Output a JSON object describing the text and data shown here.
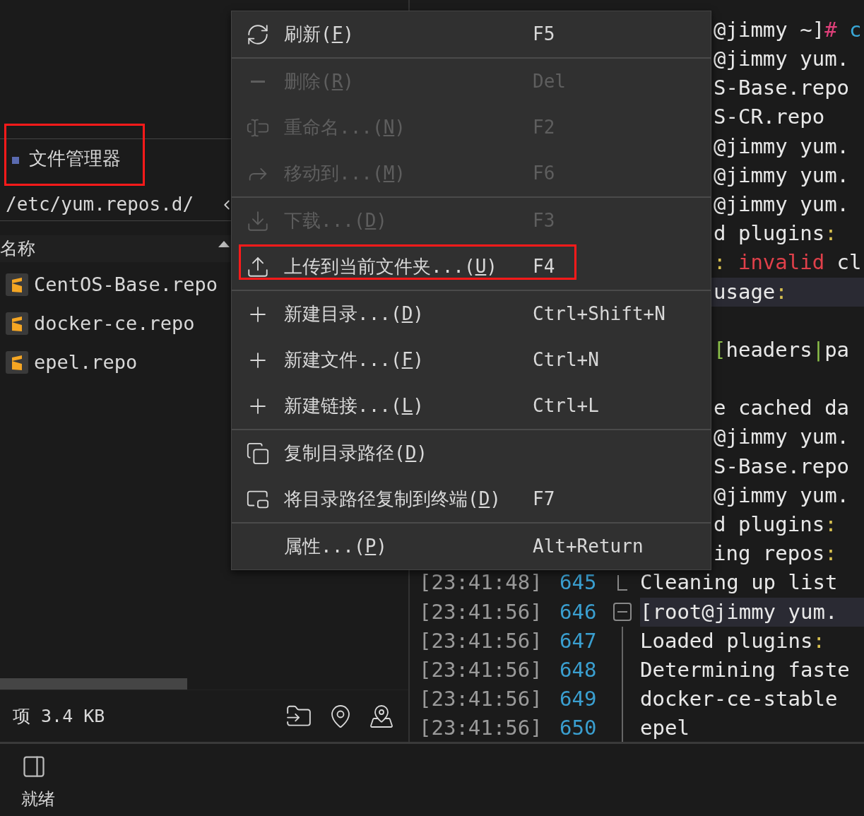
{
  "file_manager": {
    "tab": {
      "label": "文件管理器",
      "highlighted": true
    },
    "path": "/etc/yum.repos.d/",
    "column_header": "名称",
    "files": [
      {
        "name": "CentOS-Base.repo"
      },
      {
        "name": "docker-ce.repo"
      },
      {
        "name": "epel.repo"
      }
    ],
    "status": "项 3.4 KB"
  },
  "terminal": {
    "rows": [
      {
        "kind": "fragment",
        "highlighted": false,
        "segments": [
          {
            "text": "@jimmy ~]",
            "color": "#e8e8e8"
          },
          {
            "text": "#",
            "color": "#e0407a"
          },
          {
            "text": " c",
            "color": "#39a8d8"
          }
        ]
      },
      {
        "kind": "fragment",
        "highlighted": false,
        "segments": [
          {
            "text": "@jimmy yum.",
            "color": "#e8e8e8"
          }
        ]
      },
      {
        "kind": "fragment",
        "highlighted": false,
        "segments": [
          {
            "text": "S-Base.repo",
            "color": "#e8e8e8"
          }
        ]
      },
      {
        "kind": "fragment",
        "highlighted": false,
        "segments": [
          {
            "text": "S-CR.repo",
            "color": "#e8e8e8"
          }
        ]
      },
      {
        "kind": "fragment",
        "highlighted": false,
        "segments": [
          {
            "text": "@jimmy yum.",
            "color": "#e8e8e8"
          }
        ]
      },
      {
        "kind": "fragment",
        "highlighted": false,
        "segments": [
          {
            "text": "@jimmy yum.",
            "color": "#e8e8e8"
          }
        ]
      },
      {
        "kind": "fragment",
        "highlighted": false,
        "segments": [
          {
            "text": "@jimmy yum.",
            "color": "#e8e8e8"
          }
        ]
      },
      {
        "kind": "fragment",
        "highlighted": false,
        "segments": [
          {
            "text": "d plugins",
            "color": "#e8e8e8"
          },
          {
            "text": ":",
            "color": "#d8c050"
          }
        ]
      },
      {
        "kind": "fragment",
        "highlighted": false,
        "segments": [
          {
            "text": ":",
            "color": "#d8c050"
          },
          {
            "text": " invalid",
            "color": "#e0404a"
          },
          {
            "text": " cl",
            "color": "#e8e8e8"
          }
        ]
      },
      {
        "kind": "fragment",
        "highlighted": true,
        "segments": [
          {
            "text": "usage",
            "color": "#e8e8e8"
          },
          {
            "text": ":",
            "color": "#d8c050"
          }
        ]
      },
      {
        "kind": "blank"
      },
      {
        "kind": "fragment",
        "highlighted": false,
        "segments": [
          {
            "text": "[",
            "color": "#8cc04a"
          },
          {
            "text": "headers",
            "color": "#e8e8e8"
          },
          {
            "text": "|",
            "color": "#8cc04a"
          },
          {
            "text": "pa",
            "color": "#e8e8e8"
          }
        ]
      },
      {
        "kind": "blank"
      },
      {
        "kind": "fragment",
        "highlighted": false,
        "segments": [
          {
            "text": "e cached da",
            "color": "#e8e8e8"
          }
        ]
      },
      {
        "kind": "fragment",
        "highlighted": false,
        "segments": [
          {
            "text": "@jimmy yum.",
            "color": "#e8e8e8"
          }
        ]
      },
      {
        "kind": "fragment",
        "highlighted": false,
        "segments": [
          {
            "text": "S-Base.repo",
            "color": "#e8e8e8"
          }
        ]
      },
      {
        "kind": "fragment",
        "highlighted": false,
        "segments": [
          {
            "text": "@jimmy yum.",
            "color": "#e8e8e8"
          }
        ]
      },
      {
        "kind": "fragment",
        "highlighted": false,
        "segments": [
          {
            "text": "d plugins",
            "color": "#e8e8e8"
          },
          {
            "text": ":",
            "color": "#d8c050"
          }
        ]
      },
      {
        "kind": "fragment",
        "highlighted": false,
        "segments": [
          {
            "text": "ing repos",
            "color": "#e8e8e8"
          },
          {
            "text": ":",
            "color": "#d8c050"
          }
        ]
      },
      {
        "kind": "fold_end",
        "time": "[23:41:48]",
        "number": "645",
        "highlighted": false,
        "segments": [
          {
            "text": "Cleaning up list",
            "color": "#e8e8e8"
          }
        ]
      },
      {
        "kind": "fold_start",
        "time": "[23:41:56]",
        "number": "646",
        "highlighted": true,
        "segments": [
          {
            "text": "[root@jimmy yum.",
            "color": "#e8e8e8"
          }
        ]
      },
      {
        "kind": "line",
        "time": "[23:41:56]",
        "number": "647",
        "highlighted": false,
        "segments": [
          {
            "text": "Loaded plugins",
            "color": "#e8e8e8"
          },
          {
            "text": ":",
            "color": "#d8c050"
          }
        ]
      },
      {
        "kind": "line",
        "time": "[23:41:56]",
        "number": "648",
        "highlighted": false,
        "segments": [
          {
            "text": "Determining faste",
            "color": "#e8e8e8"
          }
        ]
      },
      {
        "kind": "line",
        "time": "[23:41:56]",
        "number": "649",
        "highlighted": false,
        "segments": [
          {
            "text": "docker-ce-stable",
            "color": "#e8e8e8"
          }
        ]
      },
      {
        "kind": "line",
        "time": "[23:41:56]",
        "number": "650",
        "highlighted": false,
        "segments": [
          {
            "text": "epel",
            "color": "#e8e8e8"
          }
        ]
      }
    ]
  },
  "context_menu": {
    "groups": [
      [
        {
          "before": "刷新(",
          "mnemonic": "F",
          "after": ")",
          "shortcut": "F5",
          "disabled": false,
          "highlighted": false
        }
      ],
      [
        {
          "before": "删除(",
          "mnemonic": "R",
          "after": ")",
          "shortcut": "Del",
          "disabled": true,
          "highlighted": false
        },
        {
          "before": "重命名...(",
          "mnemonic": "N",
          "after": ")",
          "shortcut": "F2",
          "disabled": true,
          "highlighted": false
        },
        {
          "before": "移动到...(",
          "mnemonic": "M",
          "after": ")",
          "shortcut": "F6",
          "disabled": true,
          "highlighted": false
        }
      ],
      [
        {
          "before": "下载...(",
          "mnemonic": "D",
          "after": ")",
          "shortcut": "F3",
          "disabled": true,
          "highlighted": false
        },
        {
          "before": "上传到当前文件夹...(",
          "mnemonic": "U",
          "after": ")",
          "shortcut": "F4",
          "disabled": false,
          "highlighted": true
        }
      ],
      [
        {
          "before": "新建目录...(",
          "mnemonic": "D",
          "after": ")",
          "shortcut": "Ctrl+Shift+N",
          "disabled": false,
          "highlighted": false
        },
        {
          "before": "新建文件...(",
          "mnemonic": "F",
          "after": ")",
          "shortcut": "Ctrl+N",
          "disabled": false,
          "highlighted": false
        },
        {
          "before": "新建链接...(",
          "mnemonic": "L",
          "after": ")",
          "shortcut": "Ctrl+L",
          "disabled": false,
          "highlighted": false
        }
      ],
      [
        {
          "before": "复制目录路径(",
          "mnemonic": "D",
          "after": ")",
          "disabled": false,
          "highlighted": false
        },
        {
          "before": "将目录路径复制到终端(",
          "mnemonic": "D",
          "after": ")",
          "shortcut": "F7",
          "disabled": false,
          "highlighted": false
        }
      ],
      [
        {
          "before": "属性...(",
          "mnemonic": "P",
          "after": ")",
          "shortcut": "Alt+Return",
          "disabled": false,
          "highlighted": false
        }
      ]
    ]
  },
  "status_bar": {
    "text": "就绪"
  }
}
